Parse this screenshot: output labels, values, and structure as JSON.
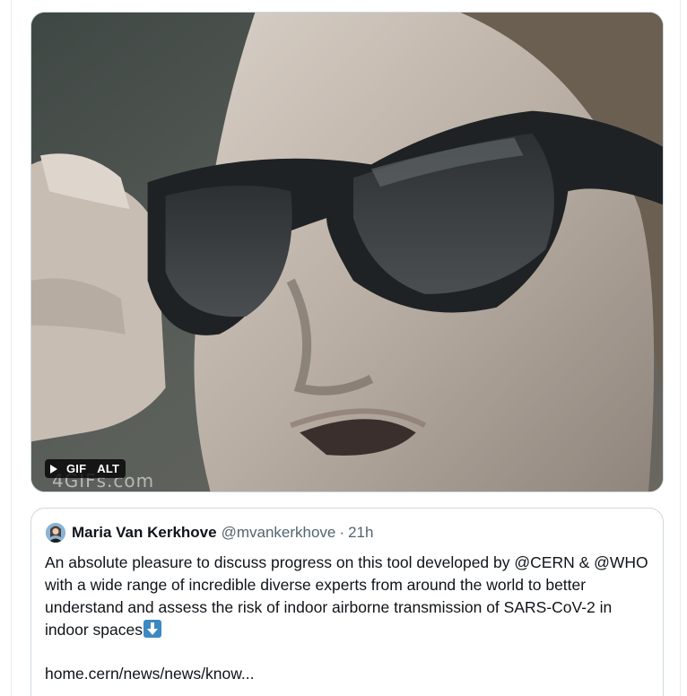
{
  "media": {
    "gif_label": "GIF",
    "alt_label": "ALT",
    "watermark": "4GIFs.com",
    "icon": "play-icon"
  },
  "quote": {
    "author_name": "Maria Van Kerkhove",
    "handle": "@mvankerkhove",
    "separator": "·",
    "time": "21h",
    "text": "An absolute pleasure to discuss progress on this tool developed by @CERN & @WHO with a wide range of incredible diverse experts from around the world to better understand and assess the risk of indoor airborne transmission of SARS-CoV-2 in indoor spaces",
    "emoji": "down-arrow-emoji",
    "link_text": "home.cern/news/news/know..."
  },
  "colors": {
    "text_primary": "#0f1419",
    "text_secondary": "#536471",
    "border": "#cfd9de"
  }
}
